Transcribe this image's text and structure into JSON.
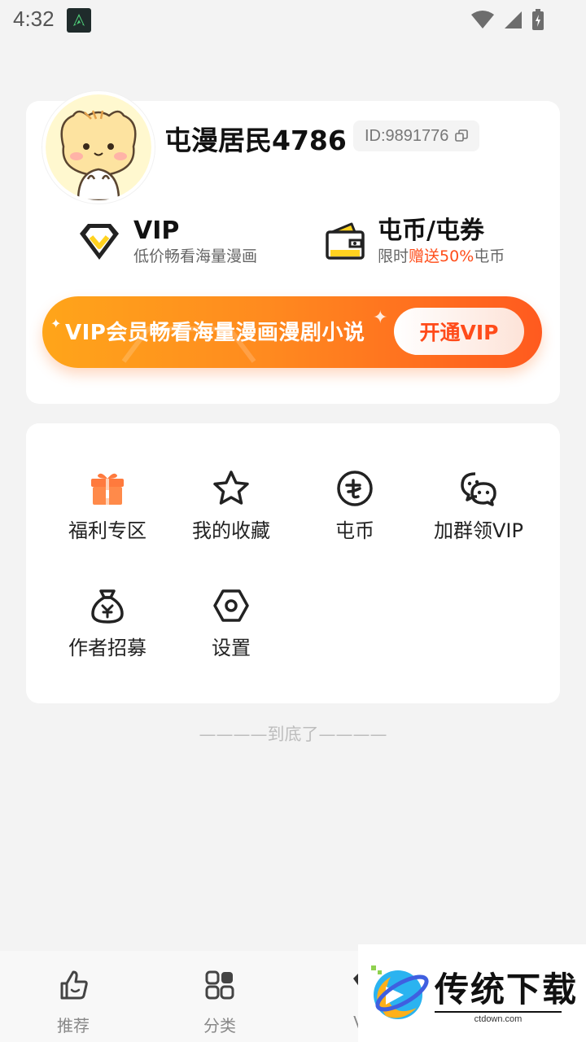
{
  "status_bar": {
    "time": "4:32"
  },
  "profile": {
    "username": "屯漫居民4786",
    "user_id": "ID:9891776"
  },
  "benefits": {
    "vip": {
      "title": "VIP",
      "subtitle": "低价畅看海量漫画"
    },
    "coin": {
      "title": "屯币/屯券",
      "subtitle_prefix": "限时",
      "subtitle_highlight": "赠送50%",
      "subtitle_suffix": "屯币"
    }
  },
  "vip_banner": {
    "text": "VIP会员畅看海量漫画漫剧小说",
    "button_label": "开通VIP"
  },
  "menu": {
    "items": [
      {
        "label": "福利专区",
        "icon": "gift-icon"
      },
      {
        "label": "我的收藏",
        "icon": "star-icon"
      },
      {
        "label": "屯币",
        "icon": "coin-icon"
      },
      {
        "label": "加群领VIP",
        "icon": "chat-icon"
      },
      {
        "label": "作者招募",
        "icon": "money-bag-icon"
      },
      {
        "label": "设置",
        "icon": "settings-icon"
      }
    ]
  },
  "bottom_hint": "————到底了————",
  "bottom_nav": {
    "items": [
      {
        "label": "推荐",
        "icon": "thumb-up-icon"
      },
      {
        "label": "分类",
        "icon": "category-icon"
      },
      {
        "label": "VIP",
        "icon": "vip-icon"
      }
    ]
  },
  "watermark": {
    "text": "传统下载",
    "url": "ctdown.com"
  },
  "colors": {
    "accent": "#ff5a1f",
    "banner_start": "#ffa51a",
    "vip_yellow": "#ffd21f"
  }
}
